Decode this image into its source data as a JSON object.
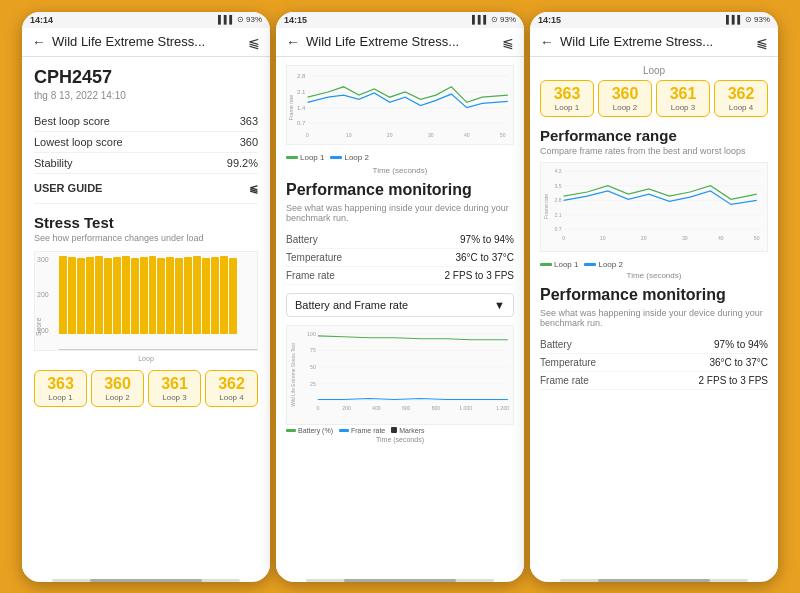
{
  "phone1": {
    "status": {
      "time": "14:14",
      "battery": "93%"
    },
    "appbar": {
      "title": "Wild Life Extreme Stress...",
      "back": "←",
      "share": "⟨"
    },
    "device": {
      "name": "CPH2457",
      "date": "thg 8 13, 2022 14:10"
    },
    "scores": [
      {
        "label": "Best loop score",
        "value": "363"
      },
      {
        "label": "Lowest loop score",
        "value": "360"
      },
      {
        "label": "Stability",
        "value": "99.2%"
      }
    ],
    "user_guide": "USER GUIDE",
    "stress_test": {
      "title": "Stress Test",
      "desc": "See how performance changes under load",
      "y_label": "Score",
      "x_label": "Loop",
      "bars": [
        100,
        98,
        97,
        98,
        99,
        97,
        98,
        99,
        97,
        98,
        99,
        97,
        98,
        97,
        98,
        99,
        97,
        98,
        99,
        97
      ]
    },
    "loop_scores": [
      {
        "num": "363",
        "label": "Loop 1"
      },
      {
        "num": "360",
        "label": "Loop 2"
      },
      {
        "num": "361",
        "label": "Loop 3"
      },
      {
        "num": "362",
        "label": "Loop 4"
      }
    ]
  },
  "phone2": {
    "status": {
      "time": "14:15",
      "battery": "93%"
    },
    "appbar": {
      "title": "Wild Life Extreme Stress...",
      "back": "←",
      "share": "⟨"
    },
    "chart": {
      "y_label": "Frame rate",
      "x_label": "Time (seconds)",
      "legend": [
        "Loop 1",
        "Loop 2"
      ]
    },
    "perf_monitoring": {
      "title": "Performance monitoring",
      "desc": "See what was happening inside your device during your benchmark run.",
      "rows": [
        {
          "label": "Battery",
          "value": "97% to 94%"
        },
        {
          "label": "Temperature",
          "value": "36°C to 37°C"
        },
        {
          "label": "Frame rate",
          "value": "2 FPS to 3 FPS"
        }
      ]
    },
    "dropdown": {
      "label": "Battery and Frame rate",
      "arrow": "▼"
    },
    "combo_chart": {
      "x_label": "Time (seconds)",
      "legend": [
        "Battery (%)",
        "Frame rate",
        "Markers"
      ]
    }
  },
  "phone3": {
    "status": {
      "time": "14:15",
      "battery": "93%"
    },
    "appbar": {
      "title": "Wild Life Extreme Stress...",
      "back": "←",
      "share": "⟨"
    },
    "loop_header": "Loop",
    "loop_scores": [
      {
        "num": "363",
        "label": "Loop 1"
      },
      {
        "num": "360",
        "label": "Loop 2"
      },
      {
        "num": "361",
        "label": "Loop 3"
      },
      {
        "num": "362",
        "label": "Loop 4"
      }
    ],
    "perf_range": {
      "title": "Performance range",
      "desc": "Compare frame rates from the best and worst loops",
      "chart": {
        "y_label": "Frame rate",
        "x_label": "Time (seconds)",
        "legend": [
          "Loop 1",
          "Loop 2"
        ]
      }
    },
    "perf_monitoring": {
      "title": "Performance monitoring",
      "desc": "See what was happening inside your device during your benchmark run.",
      "rows": [
        {
          "label": "Battery",
          "value": "97% to 94%"
        },
        {
          "label": "Temperature",
          "value": "36°C to 37°C"
        },
        {
          "label": "Frame rate",
          "value": "2 FPS to 3 FPS"
        }
      ]
    }
  },
  "colors": {
    "gold": "#f0b800",
    "accent": "#e8a020",
    "loop1": "#4caf50",
    "loop2": "#2196f3"
  }
}
